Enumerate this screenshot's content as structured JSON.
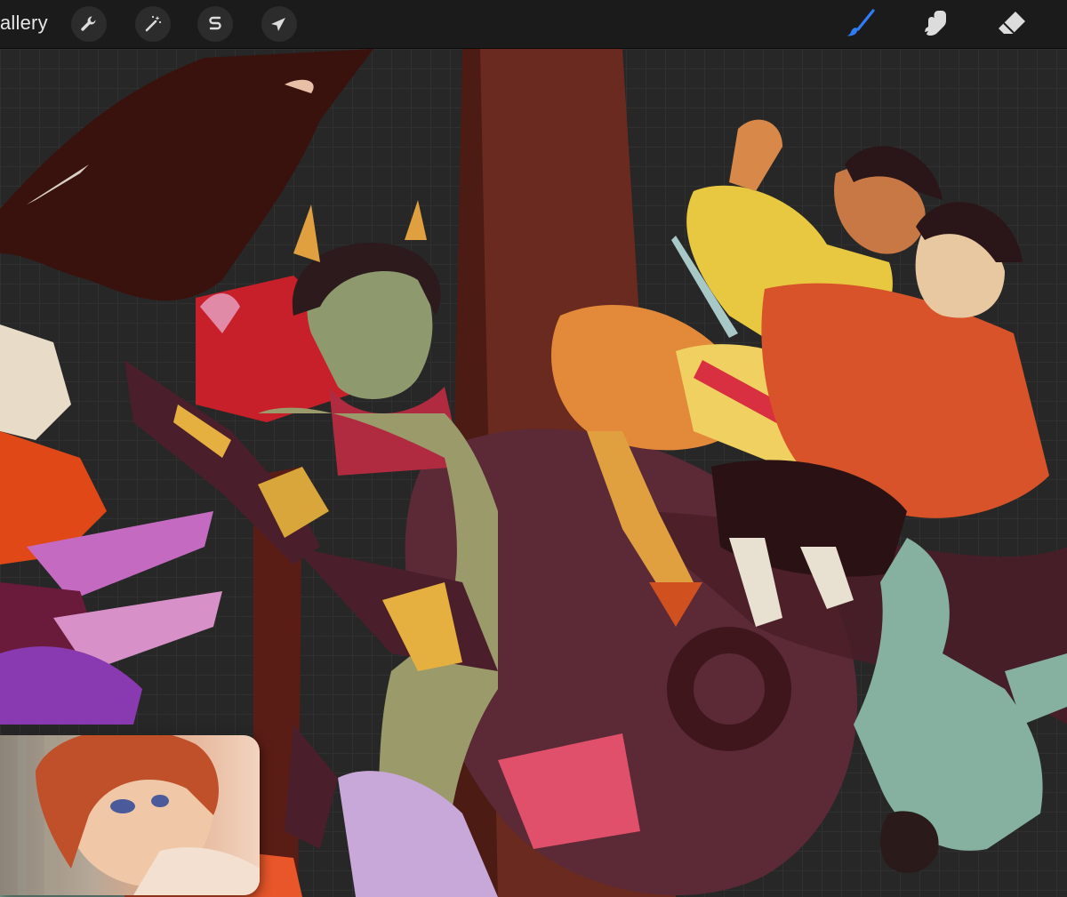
{
  "toolbar": {
    "gallery_label": "allery",
    "left_tools": [
      {
        "name": "actions",
        "icon": "wrench-icon"
      },
      {
        "name": "adjustments",
        "icon": "magic-wand-icon"
      },
      {
        "name": "selection",
        "icon": "selection-s-icon"
      },
      {
        "name": "transform",
        "icon": "arrow-cursor-icon"
      }
    ],
    "right_tools": [
      {
        "name": "brush",
        "icon": "brush-icon",
        "active": true
      },
      {
        "name": "smudge",
        "icon": "smudge-finger-icon"
      },
      {
        "name": "eraser",
        "icon": "eraser-icon"
      }
    ]
  },
  "colors": {
    "toolbar_bg": "#1b1b1b",
    "canvas_bg": "#272727",
    "active_tool": "#2f7cf6",
    "icon": "#dcdcdc"
  },
  "pip_video": {
    "visible": true
  }
}
